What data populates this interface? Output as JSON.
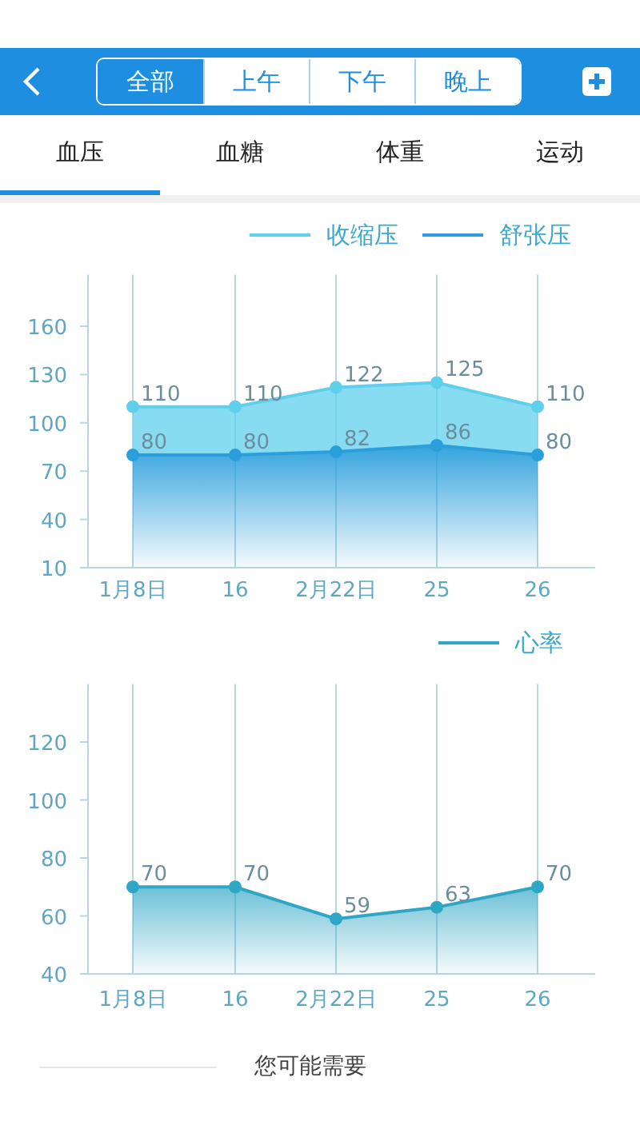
{
  "header": {
    "segments": [
      {
        "label": "全部",
        "selected": true
      },
      {
        "label": "上午",
        "selected": false
      },
      {
        "label": "下午",
        "selected": false
      },
      {
        "label": "晚上",
        "selected": false
      }
    ]
  },
  "tabs": [
    {
      "label": "血压",
      "selected": true
    },
    {
      "label": "血糖",
      "selected": false
    },
    {
      "label": "体重",
      "selected": false
    },
    {
      "label": "运动",
      "selected": false
    }
  ],
  "charts": [
    {
      "chart_data": {
        "type": "area",
        "categories": [
          "1月8日",
          "16",
          "2月22日",
          "25",
          "26"
        ],
        "grid": true,
        "legend": "top-right",
        "ylim": [
          10,
          192
        ],
        "yticks": [
          10,
          40,
          70,
          100,
          130,
          160
        ],
        "data_labels": true,
        "series": [
          {
            "name": "收缩压",
            "color": "#5fd0ec",
            "values": [
              110,
              110,
              122,
              125,
              110
            ]
          },
          {
            "name": "舒张压",
            "color": "#2a9fdc",
            "values": [
              80,
              80,
              82,
              86,
              80
            ]
          }
        ]
      }
    },
    {
      "chart_data": {
        "type": "area",
        "categories": [
          "1月8日",
          "16",
          "2月22日",
          "25",
          "26"
        ],
        "grid": true,
        "legend": "top-right",
        "ylim": [
          40,
          140
        ],
        "yticks": [
          40,
          60,
          80,
          100,
          120
        ],
        "data_labels": true,
        "series": [
          {
            "name": "心率",
            "color": "#2fa6c6",
            "values": [
              70,
              70,
              59,
              63,
              70
            ]
          }
        ]
      }
    }
  ],
  "footer": {
    "title": "您可能需要"
  }
}
